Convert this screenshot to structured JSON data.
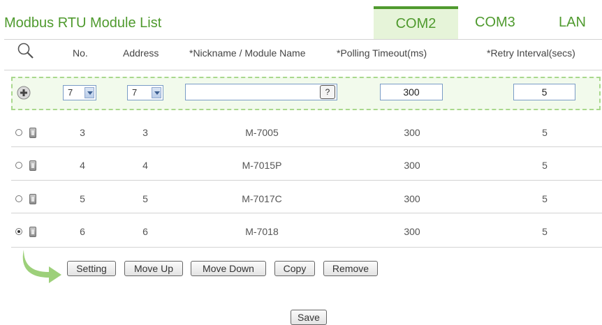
{
  "title": "Modbus RTU Module List",
  "tabs": [
    "COM2",
    "COM3",
    "LAN"
  ],
  "columns": {
    "no": "No.",
    "address": "Address",
    "name": "*Nickname / Module Name",
    "timeout": "*Polling Timeout(ms)",
    "retry": "*Retry Interval(secs)"
  },
  "add_row": {
    "no_value": "7",
    "address_value": "7",
    "name_value": "",
    "help_label": "?",
    "timeout_value": "300",
    "retry_value": "5"
  },
  "rows": [
    {
      "no": "3",
      "address": "3",
      "name": "M-7005",
      "timeout": "300",
      "retry": "5",
      "selected": false
    },
    {
      "no": "4",
      "address": "4",
      "name": "M-7015P",
      "timeout": "300",
      "retry": "5",
      "selected": false
    },
    {
      "no": "5",
      "address": "5",
      "name": "M-7017C",
      "timeout": "300",
      "retry": "5",
      "selected": false
    },
    {
      "no": "6",
      "address": "6",
      "name": "M-7018",
      "timeout": "300",
      "retry": "5",
      "selected": true
    }
  ],
  "actions": {
    "setting": "Setting",
    "move_up": "Move Up",
    "move_down": "Move Down",
    "copy": "Copy",
    "remove": "Remove"
  },
  "save_label": "Save",
  "colors": {
    "accent": "#4f9a2e",
    "add_row_bg": "#f2faec",
    "add_row_border": "#a9d88d"
  }
}
